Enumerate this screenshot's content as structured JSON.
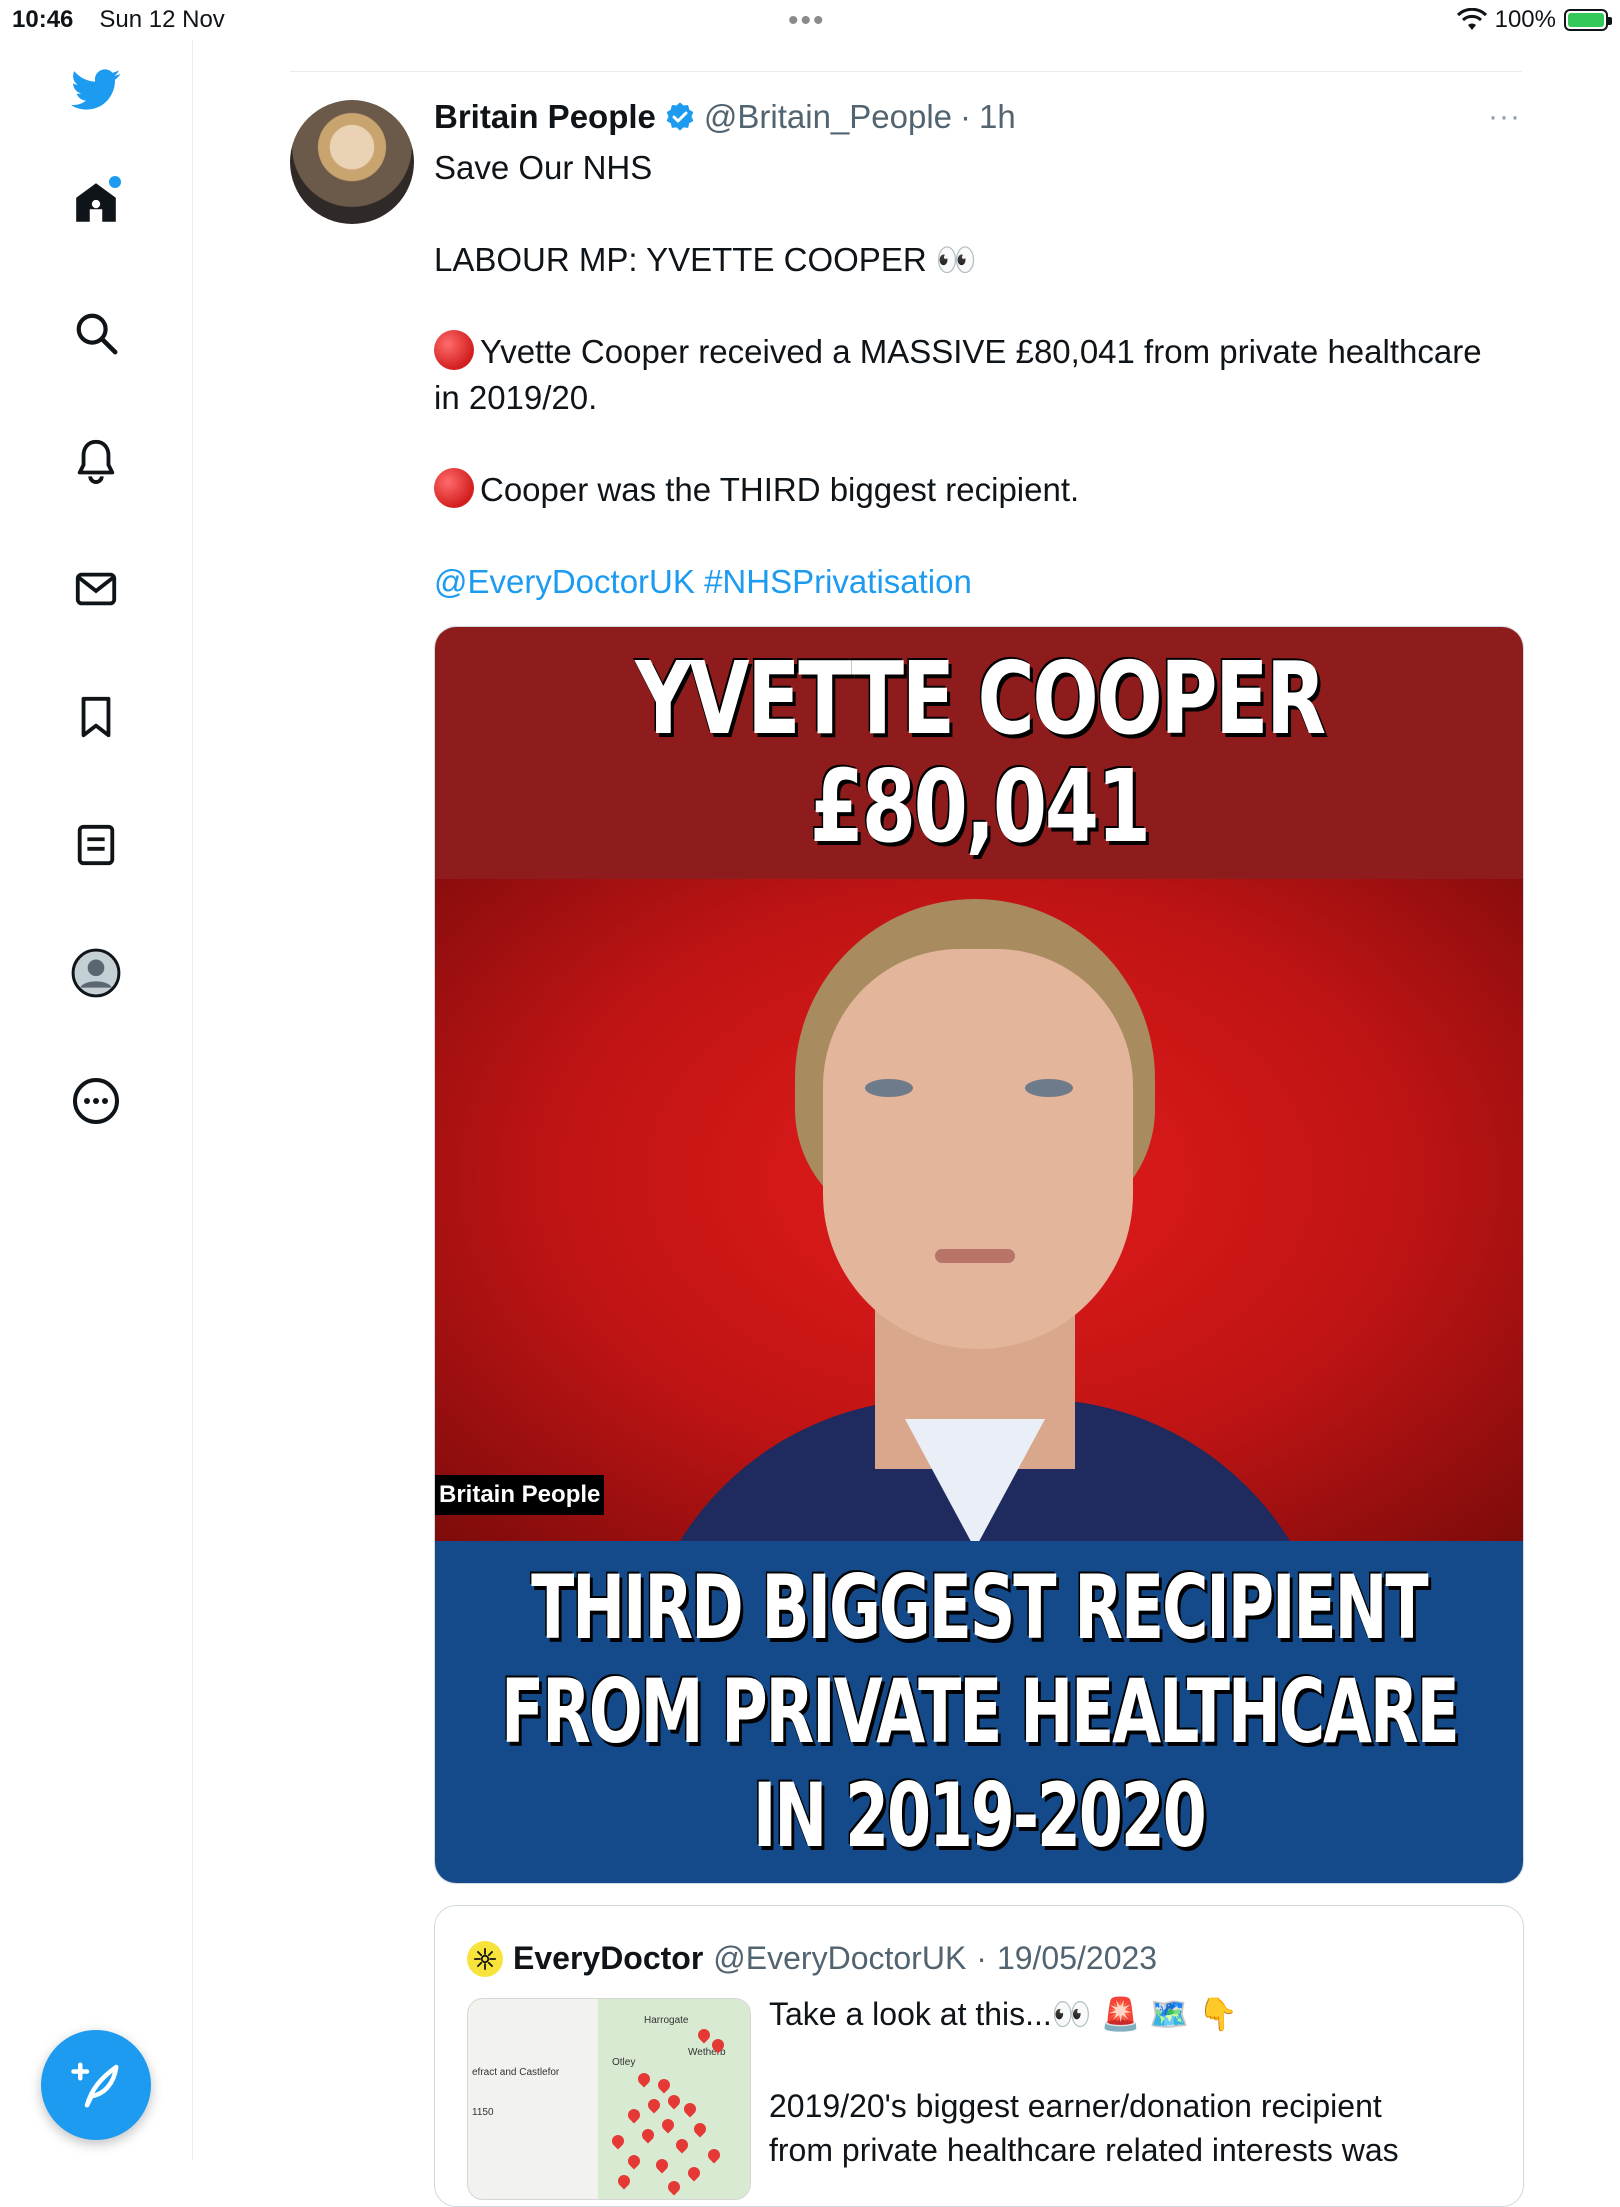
{
  "status_bar": {
    "time": "10:46",
    "date": "Sun 12 Nov",
    "battery": "100%"
  },
  "sidebar": {
    "items": [
      {
        "icon": "twitter-bird-icon"
      },
      {
        "icon": "home-icon"
      },
      {
        "icon": "search-icon"
      },
      {
        "icon": "bell-icon"
      },
      {
        "icon": "mail-icon"
      },
      {
        "icon": "bookmark-icon"
      },
      {
        "icon": "list-icon"
      },
      {
        "icon": "profile-icon"
      },
      {
        "icon": "more-icon"
      }
    ]
  },
  "tweet": {
    "display_name": "Britain People",
    "handle": "@Britain_People",
    "separator": "·",
    "time": "1h",
    "more": "···",
    "lines": {
      "l1": "Save Our NHS",
      "l2": "LABOUR MP:  YVETTE COOPER 👀",
      "l3": "Yvette Cooper received a MASSIVE £80,041 from private healthcare",
      "l4": "in 2019/20.",
      "l5": "Cooper was the THIRD biggest recipient.",
      "mention": "@EveryDoctorUK",
      "hashtag": "#NHSPrivatisation"
    },
    "image": {
      "top_line1": "YVETTE COOPER",
      "top_line2": "£80,041",
      "watermark": "Britain People",
      "bottom_line1": "THIRD BIGGEST RECIPIENT",
      "bottom_line2": "FROM PRIVATE HEALTHCARE",
      "bottom_line3": "IN 2019-2020"
    }
  },
  "quote": {
    "display_name": "EveryDoctor",
    "handle": "@EveryDoctorUK",
    "separator": "·",
    "date": "19/05/2023",
    "line1": "Take a look at this...👀 🚨 🗺️ 👇",
    "line2": "2019/20's biggest earner/donation recipient",
    "line3": "from private healthcare related interests was",
    "map_labels": {
      "a": "efract and Castlefor",
      "b": "1150",
      "c": "Harrogate",
      "d": "Otley",
      "e": "Wetherb"
    }
  },
  "colors": {
    "accent": "#1d9bf0",
    "red_banner": "#8e1c1c",
    "blue_banner": "#144a8a"
  }
}
